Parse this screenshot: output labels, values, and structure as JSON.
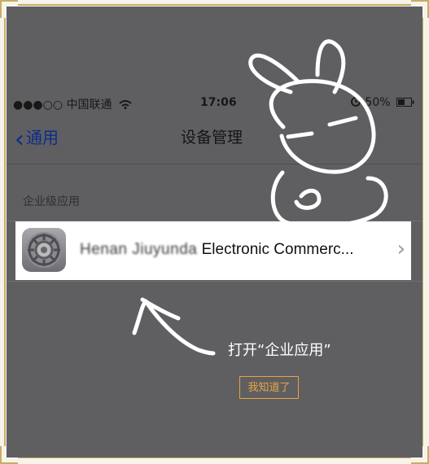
{
  "status_bar": {
    "carrier": "●●●○○ 中国联通",
    "time": "17:06",
    "battery": "50%"
  },
  "nav": {
    "back_label": "通用",
    "title": "设备管理"
  },
  "section": {
    "header": "企业级应用"
  },
  "app_row": {
    "blurred_name": "Henan Jiuyunda",
    "name_suffix": " Electronic Commerc..."
  },
  "guide": {
    "hint": "打开“企业应用”",
    "button": "我知道了"
  },
  "colors": {
    "overlay": "#5f5f62",
    "accent": "#e8a441",
    "ios_blue": "#0b2d88",
    "frame": "#c9ab68"
  },
  "icons": {
    "wifi": "wifi-icon",
    "alarm": "alarm-icon",
    "battery": "battery-icon",
    "settings": "settings-gear-icon",
    "chevron": "chevron-right-icon"
  }
}
